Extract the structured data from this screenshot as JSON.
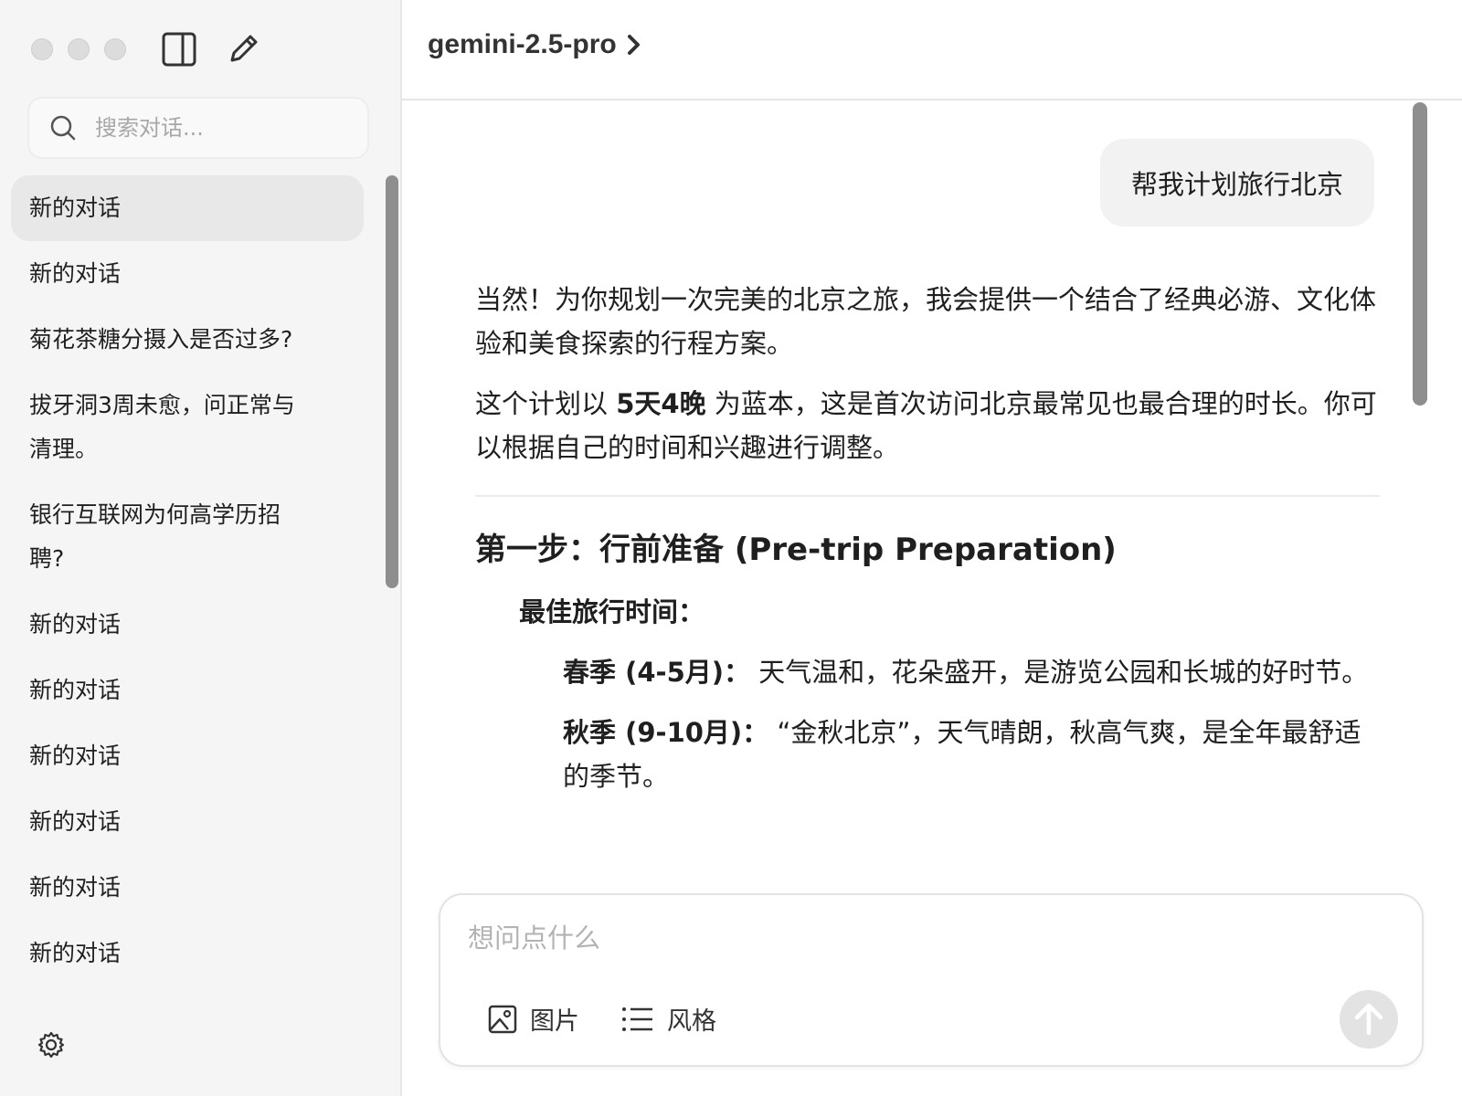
{
  "sidebar": {
    "search_placeholder": "搜索对话...",
    "conversations": [
      {
        "label": "新的对话"
      },
      {
        "label": "新的对话"
      },
      {
        "label": "菊花茶糖分摄入是否过多?"
      },
      {
        "label": "拔牙洞3周未愈，问正常与清理。"
      },
      {
        "label": "银行互联网为何高学历招聘?"
      },
      {
        "label": "新的对话"
      },
      {
        "label": "新的对话"
      },
      {
        "label": "新的对话"
      },
      {
        "label": "新的对话"
      },
      {
        "label": "新的对话"
      },
      {
        "label": "新的对话"
      }
    ]
  },
  "header": {
    "model_name": "gemini-2.5-pro"
  },
  "chat": {
    "user_message": "帮我计划旅行北京",
    "assistant": {
      "intro": "当然！为你规划一次完美的北京之旅，我会提供一个结合了经典必游、文化体验和美食探索的行程方案。",
      "plan_prefix": "这个计划以 ",
      "plan_bold": "5天4晚",
      "plan_suffix": " 为蓝本，这是首次访问北京最常见也最合理的时长。你可以根据自己的时间和兴趣进行调整。",
      "step1_heading": "第一步：行前准备 (Pre-trip Preparation)",
      "best_time_label": "最佳旅行时间：",
      "spring_label": "春季 (4-5月)：",
      "spring_text": " 天气温和，花朵盛开，是游览公园和长城的好时节。",
      "autumn_label": "秋季 (9-10月)：",
      "autumn_text": " “金秋北京”，天气晴朗，秋高气爽，是全年最舒适的季节。"
    }
  },
  "composer": {
    "placeholder": "想问点什么",
    "image_label": "图片",
    "style_label": "风格"
  },
  "icons": {
    "search": "search-icon",
    "toggle_sidebar": "sidebar-toggle-icon",
    "new_chat": "pencil-icon",
    "settings": "gear-icon",
    "chevron": "chevron-right-icon",
    "image": "image-icon",
    "list": "list-icon",
    "send": "arrow-up-icon"
  }
}
